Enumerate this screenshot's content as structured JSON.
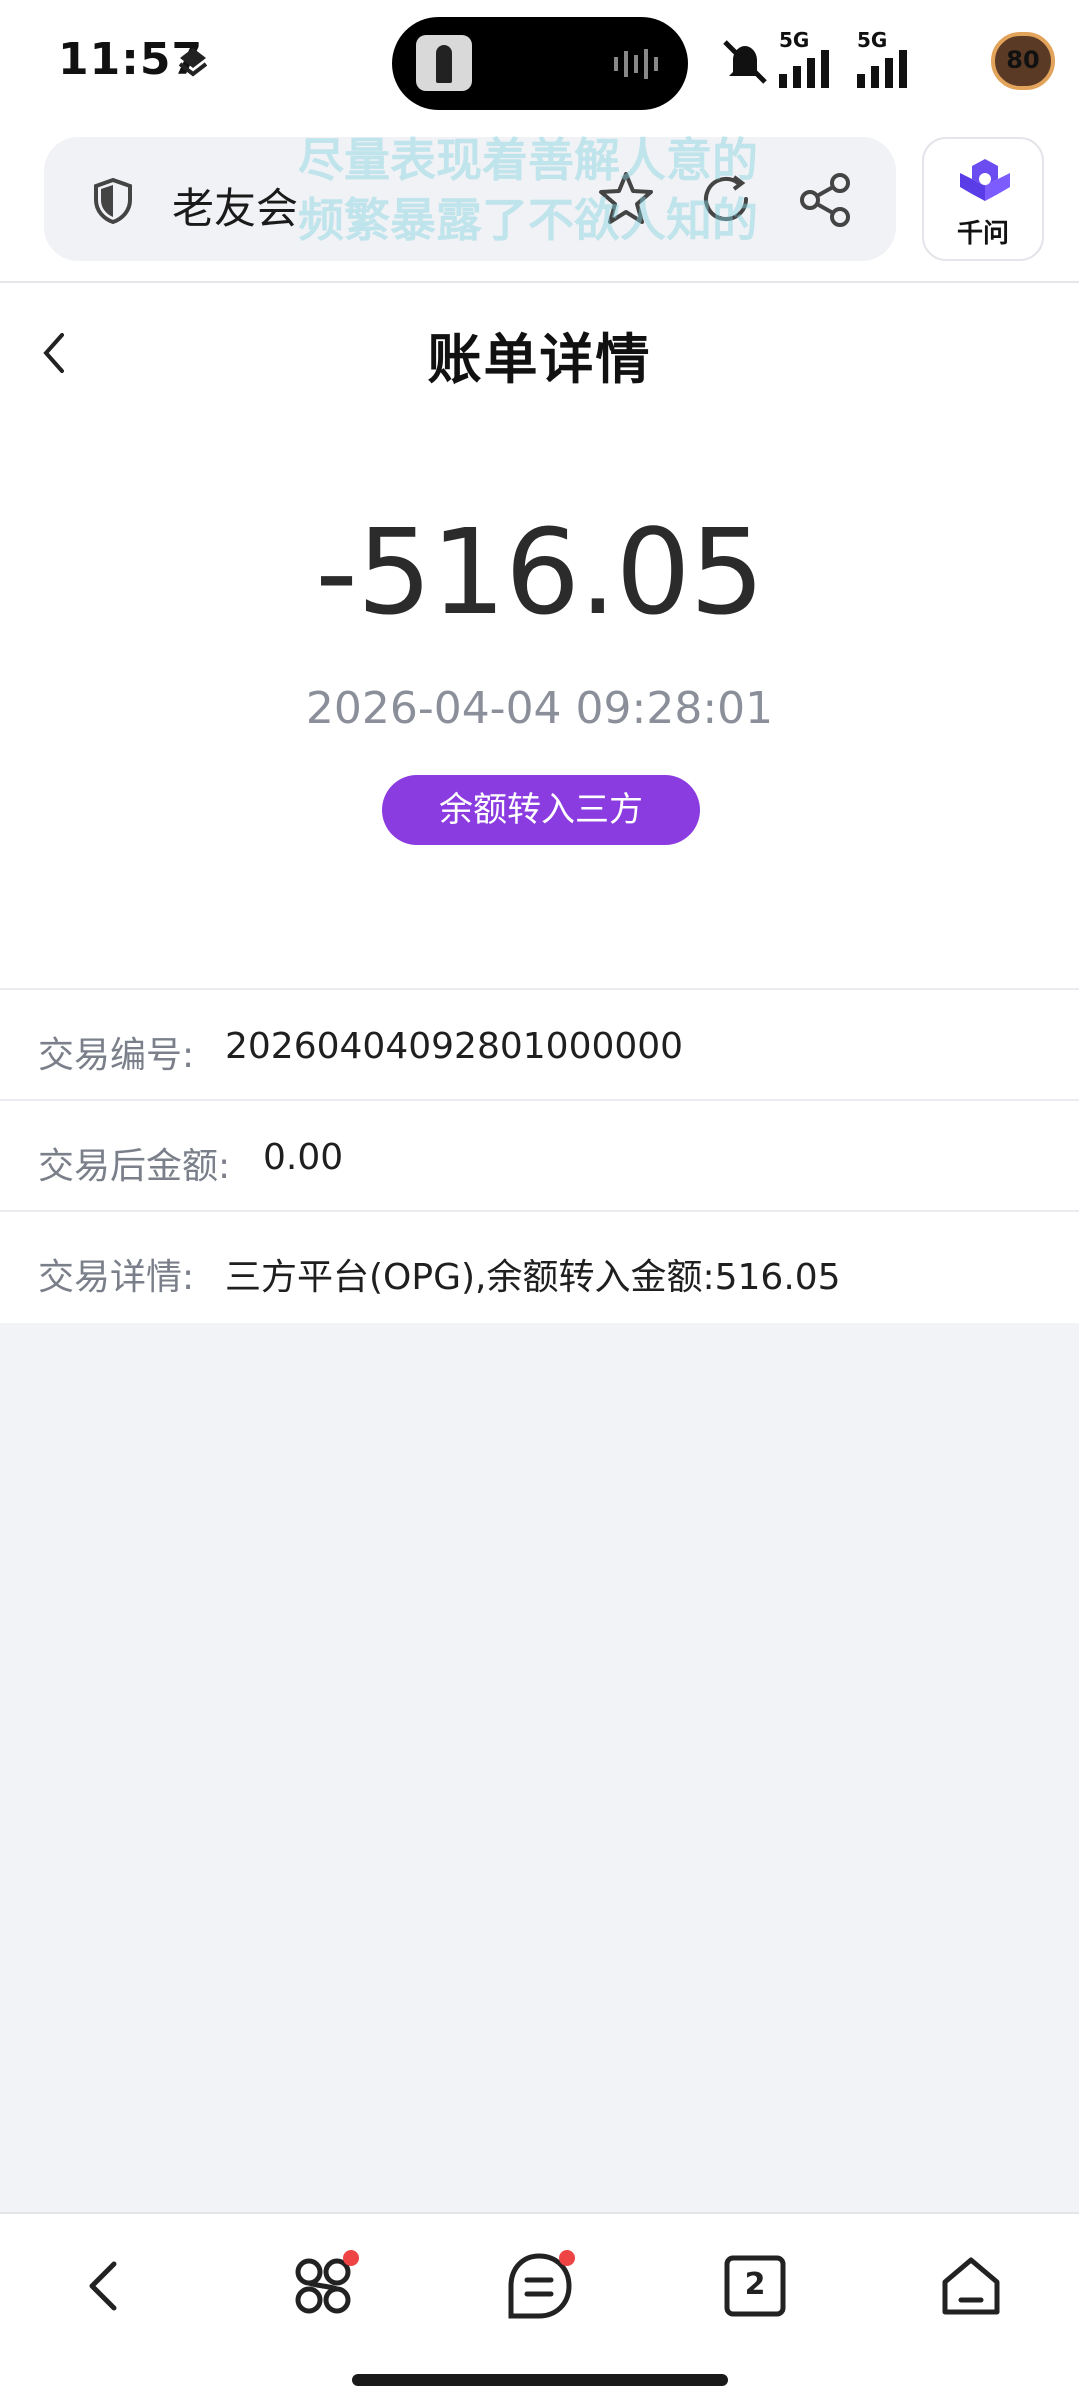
{
  "status_bar": {
    "time": "11:57",
    "network_1": "5G",
    "network_2": "5G",
    "battery": "80"
  },
  "browser": {
    "site_title": "老友会",
    "overlay_line_1": "尽量表现着善解人意的",
    "overlay_line_2": "频繁暴露了不欲人知的",
    "assistant_label": "千问"
  },
  "page": {
    "title": "账单详情",
    "amount": "-516.05",
    "datetime": "2026-04-04 09:28:01",
    "type_badge": "余额转入三方",
    "accent_color": "#8b3ce0"
  },
  "details": [
    {
      "label": "交易编号:",
      "value": "20260404092801000000"
    },
    {
      "label": "交易后金额:",
      "value": "0.00"
    },
    {
      "label": "交易详情:",
      "value": "三方平台(OPG),余额转入金额:516.05"
    }
  ],
  "nav": {
    "items": [
      "back-icon",
      "apps-icon",
      "menu-icon",
      "tabs-icon",
      "home-icon"
    ],
    "tab_count": "2"
  }
}
